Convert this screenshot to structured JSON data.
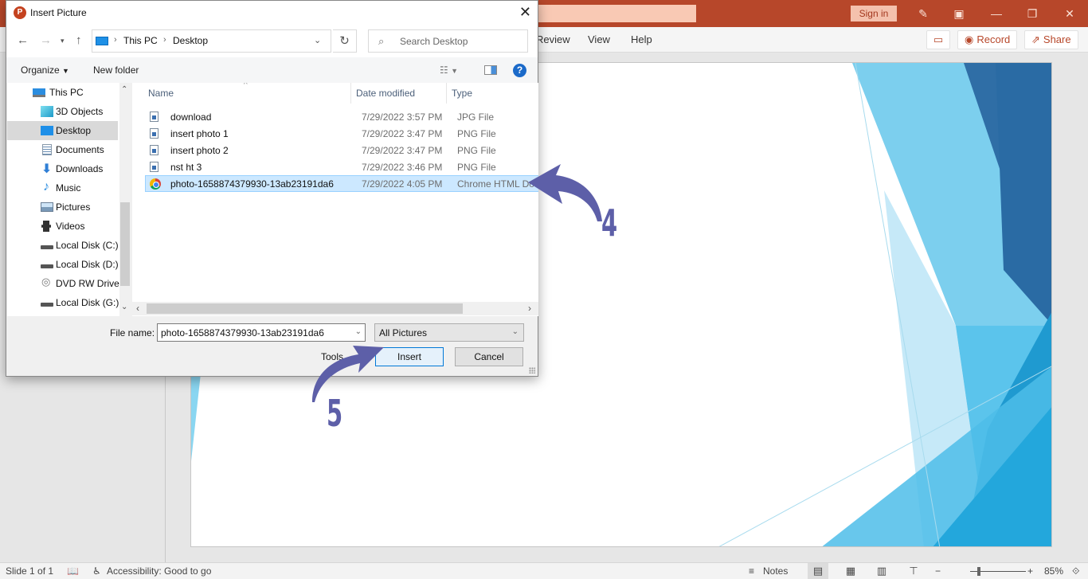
{
  "powerpoint": {
    "signin_label": "Sign in",
    "ribbon_tabs": [
      "Review",
      "View",
      "Help"
    ],
    "comments_icon": "comment-icon",
    "record_label": "Record",
    "share_label": "Share",
    "window_controls": [
      "designer-icon",
      "ribbon-display-icon",
      "minimize-icon",
      "restore-icon",
      "close-icon"
    ]
  },
  "dialog": {
    "title": "Insert Picture",
    "address": {
      "crumbs": [
        "This PC",
        "Desktop"
      ]
    },
    "search_placeholder": "Search Desktop",
    "toolbar": {
      "organize_label": "Organize",
      "new_folder_label": "New folder"
    },
    "nav_items": [
      {
        "label": "This PC",
        "icon": "pc-icon",
        "selected": false
      },
      {
        "label": "3D Objects",
        "icon": "3d-objects-icon",
        "selected": false
      },
      {
        "label": "Desktop",
        "icon": "desktop-icon",
        "selected": true
      },
      {
        "label": "Documents",
        "icon": "documents-icon",
        "selected": false
      },
      {
        "label": "Downloads",
        "icon": "downloads-icon",
        "selected": false
      },
      {
        "label": "Music",
        "icon": "music-icon",
        "selected": false
      },
      {
        "label": "Pictures",
        "icon": "pictures-icon",
        "selected": false
      },
      {
        "label": "Videos",
        "icon": "videos-icon",
        "selected": false
      },
      {
        "label": "Local Disk (C:)",
        "icon": "drive-icon",
        "selected": false
      },
      {
        "label": "Local Disk (D:)",
        "icon": "drive-icon",
        "selected": false
      },
      {
        "label": "DVD RW Drive",
        "icon": "dvd-drive-icon",
        "selected": false
      },
      {
        "label": "Local Disk (G:)",
        "icon": "drive-icon",
        "selected": false
      }
    ],
    "columns": [
      "Name",
      "Date modified",
      "Type"
    ],
    "files": [
      {
        "name": "download",
        "date": "7/29/2022 3:57 PM",
        "type": "JPG File",
        "icon": "image-file-icon",
        "selected": false
      },
      {
        "name": "insert photo 1",
        "date": "7/29/2022 3:47 PM",
        "type": "PNG File",
        "icon": "image-file-icon",
        "selected": false
      },
      {
        "name": "insert photo 2",
        "date": "7/29/2022 3:47 PM",
        "type": "PNG File",
        "icon": "image-file-icon",
        "selected": false
      },
      {
        "name": "nst ht 3",
        "date": "7/29/2022 3:46 PM",
        "type": "PNG File",
        "icon": "image-file-icon",
        "selected": false
      },
      {
        "name": "photo-1658874379930-13ab23191da6",
        "date": "7/29/2022 4:05 PM",
        "type": "Chrome HTML Do",
        "icon": "chrome-icon",
        "selected": true
      }
    ],
    "file_name_label": "File name:",
    "file_name_value": "photo-1658874379930-13ab23191da6",
    "filter_value": "All Pictures",
    "tools_label": "Tools",
    "insert_label": "Insert",
    "cancel_label": "Cancel"
  },
  "annotations": [
    {
      "number": "4",
      "target": "selected file row"
    },
    {
      "number": "5",
      "target": "Insert button"
    }
  ],
  "statusbar": {
    "slide_info": "Slide 1 of 1",
    "accessibility": "Accessibility: Good to go",
    "notes_label": "Notes",
    "zoom_level": "85%"
  },
  "colors": {
    "ppt_brand": "#b7472a",
    "annotation": "#5d5fa8",
    "selection": "#cce8ff"
  }
}
